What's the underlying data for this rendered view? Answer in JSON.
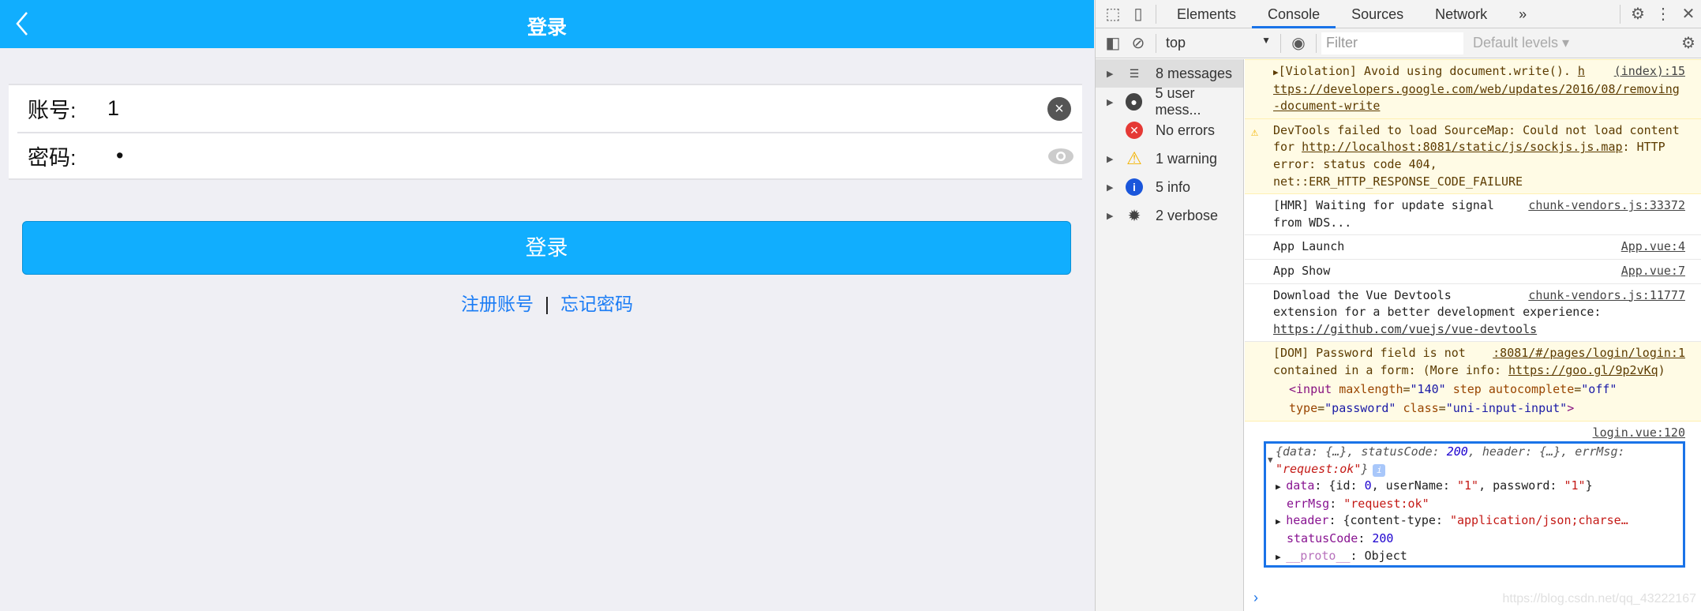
{
  "app": {
    "title": "登录",
    "account_label": "账号:",
    "account_value": "1",
    "password_label": "密码:",
    "password_value": "•",
    "login_button": "登录",
    "register_link": "注册账号",
    "separator": "|",
    "forgot_link": "忘记密码",
    "accent": "#11aefe"
  },
  "devtools": {
    "tabs": [
      "Elements",
      "Console",
      "Sources",
      "Network"
    ],
    "more": "»",
    "active_tab": "Console",
    "context": "top",
    "filter_placeholder": "Filter",
    "levels": "Default levels ▾",
    "sidebar": [
      {
        "label": "8 messages",
        "icon": "list-icon"
      },
      {
        "label": "5 user mess...",
        "icon": "user-icon"
      },
      {
        "label": "No errors",
        "icon": "error-icon"
      },
      {
        "label": "1 warning",
        "icon": "warning-icon"
      },
      {
        "label": "5 info",
        "icon": "info-icon"
      },
      {
        "label": "2 verbose",
        "icon": "bug-icon"
      }
    ],
    "messages": {
      "violation": {
        "src": "(index):15",
        "text": "[Violation] Avoid using document.write(). ",
        "link": "https://developers.google.com/web/updates/2016/08/removing-document-write"
      },
      "sourcemap": {
        "text1": "DevTools failed to load SourceMap: Could not load content for ",
        "link": "http://localhost:8081/static/js/sockjs.js.map",
        "text2": ": HTTP error: status code 404, net::ERR_HTTP_RESPONSE_CODE_FAILURE"
      },
      "hmr": {
        "src": "chunk-vendors.js:33372",
        "text": "[HMR] Waiting for update signal from WDS..."
      },
      "launch": {
        "src": "App.vue:4",
        "text": "App Launch"
      },
      "show": {
        "src": "App.vue:7",
        "text": "App Show"
      },
      "vue": {
        "src": "chunk-vendors.js:11777",
        "text": "Download the Vue Devtools extension for a better development experience: ",
        "link": "https://github.com/vuejs/vue-devtools"
      },
      "dom": {
        "src": ":8081/#/pages/login/login:1",
        "text1": "[DOM] Password field is not contained in a form: (More info: ",
        "link": "https://goo.gl/9p2vKq",
        "text2": ")"
      },
      "login": {
        "src": "login.vue:120",
        "summary": "{data: {…}, statusCode: ",
        "summary_code": "200",
        "summary2": ", header: {…}, errMsg: ",
        "summary_err": "\"request:ok\"",
        "summary_end": "}",
        "data_key": "data",
        "data_val1": ": {id: ",
        "data_id": "0",
        "data_val2": ", userName: ",
        "data_user": "\"1\"",
        "data_val3": ", password: ",
        "data_pw": "\"1\"",
        "data_end": "}",
        "err_key": "errMsg",
        "err_val": "\"request:ok\"",
        "header_key": "header",
        "header_val": ": {content-type: ",
        "header_str": "\"application/json;charse…",
        "status_key": "statusCode",
        "status_val": "200",
        "proto_key": "__proto__",
        "proto_val": ": Object"
      }
    },
    "watermark": "https://blog.csdn.net/qq_43222167"
  }
}
